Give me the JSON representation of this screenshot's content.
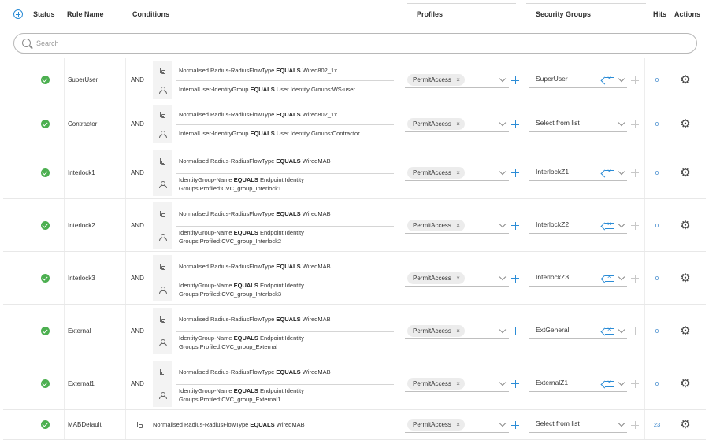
{
  "header": {
    "status": "Status",
    "rule_name": "Rule Name",
    "conditions": "Conditions",
    "profiles": "Profiles",
    "security_groups": "Security Groups",
    "hits": "Hits",
    "actions": "Actions"
  },
  "search": {
    "placeholder": "Search"
  },
  "colors": {
    "accent": "#2b8cd6",
    "status_ok": "#4caf50"
  },
  "rows": [
    {
      "name": "SuperUser",
      "and": "AND",
      "cond1": [
        "Normalised Radius-RadiusFlowType",
        "EQUALS",
        "Wired802_1x"
      ],
      "cond2": [
        "InternalUser-IdentityGroup",
        "EQUALS",
        "User Identity Groups:WS-user"
      ],
      "profile": "PermitAccess",
      "sg": "SuperUser",
      "hits": "0"
    },
    {
      "name": "Contractor",
      "and": "AND",
      "cond1": [
        "Normalised Radius-RadiusFlowType",
        "EQUALS",
        "Wired802_1x"
      ],
      "cond2": [
        "InternalUser-IdentityGroup",
        "EQUALS",
        "User Identity Groups:Contractor"
      ],
      "profile": "PermitAccess",
      "sg": "Select from list",
      "hits": "0"
    },
    {
      "name": "Interlock1",
      "and": "AND",
      "cond1": [
        "Normalised Radius-RadiusFlowType",
        "EQUALS",
        "WiredMAB"
      ],
      "cond2": [
        "IdentityGroup-Name",
        "EQUALS",
        "Endpoint Identity",
        "Groups:Profiled:CVC_group_Interlock1"
      ],
      "profile": "PermitAccess",
      "sg": "InterlockZ1",
      "hits": "0"
    },
    {
      "name": "Interlock2",
      "and": "AND",
      "cond1": [
        "Normalised Radius-RadiusFlowType",
        "EQUALS",
        "WiredMAB"
      ],
      "cond2": [
        "IdentityGroup-Name",
        "EQUALS",
        "Endpoint Identity",
        "Groups:Profiled:CVC_group_Interlock2"
      ],
      "profile": "PermitAccess",
      "sg": "InterlockZ2",
      "hits": "0"
    },
    {
      "name": "Interlock3",
      "and": "AND",
      "cond1": [
        "Normalised Radius-RadiusFlowType",
        "EQUALS",
        "WiredMAB"
      ],
      "cond2": [
        "IdentityGroup-Name",
        "EQUALS",
        "Endpoint Identity",
        "Groups:Profiled:CVC_group_Interlock3"
      ],
      "profile": "PermitAccess",
      "sg": "InterlockZ3",
      "hits": "0"
    },
    {
      "name": "External",
      "and": "AND",
      "cond1": [
        "Normalised Radius-RadiusFlowType",
        "EQUALS",
        "WiredMAB"
      ],
      "cond2": [
        "IdentityGroup-Name",
        "EQUALS",
        "Endpoint Identity",
        "Groups:Profiled:CVC_group_External"
      ],
      "profile": "PermitAccess",
      "sg": "ExtGeneral",
      "hits": "0"
    },
    {
      "name": "External1",
      "and": "AND",
      "cond1": [
        "Normalised Radius-RadiusFlowType",
        "EQUALS",
        "WiredMAB"
      ],
      "cond2": [
        "IdentityGroup-Name",
        "EQUALS",
        "Endpoint Identity",
        "Groups:Profiled:CVC_group_External1"
      ],
      "profile": "PermitAccess",
      "sg": "ExternalZ1",
      "hits": "0"
    },
    {
      "name": "MABDefault",
      "cond1": [
        "Normalised Radius-RadiusFlowType",
        "EQUALS",
        "WiredMAB"
      ],
      "profile": "PermitAccess",
      "sg": "Select from list",
      "hits": "23"
    }
  ]
}
